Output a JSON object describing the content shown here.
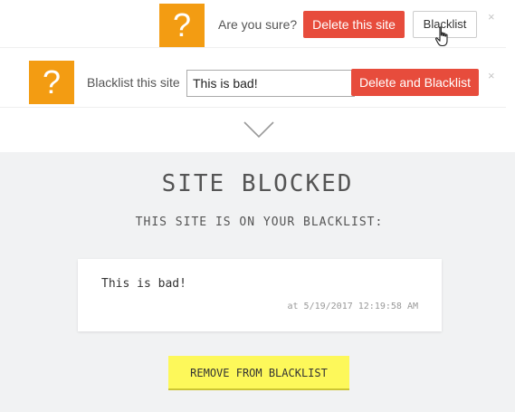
{
  "confirm_bar": {
    "icon_glyph": "?",
    "prompt": "Are you sure?",
    "delete_label": "Delete this site",
    "blacklist_label": "Blacklist",
    "close_glyph": "×"
  },
  "blacklist_bar": {
    "icon_glyph": "?",
    "prompt": "Blacklist this site",
    "reason_value": "This is bad!",
    "delete_blacklist_label": "Delete and Blacklist",
    "close_glyph": "×"
  },
  "blocked_page": {
    "title": "SITE BLOCKED",
    "subtitle": "THIS SITE IS ON YOUR BLACKLIST:",
    "reason_text": "This is bad!",
    "timestamp": "at 5/19/2017 12:19:58 AM",
    "remove_label": "REMOVE FROM BLACKLIST"
  },
  "icons": {
    "question": "question-icon",
    "cursor": "hand-pointer-icon",
    "chevron": "chevron-down-icon",
    "close": "close-icon"
  },
  "colors": {
    "icon_orange": "#f39c12",
    "danger_red": "#e74c3c",
    "panel_gray": "#f1f2f3",
    "highlight_yellow": "#fdf85a"
  }
}
